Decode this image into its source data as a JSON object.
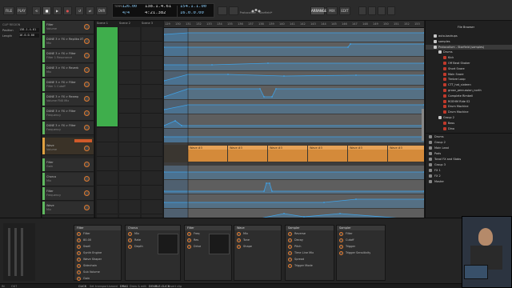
{
  "toolbar": {
    "buttons": [
      "FILE",
      "PLAY",
      "⟲",
      "■",
      "▶",
      "●",
      "↺",
      "⇄",
      "OVR"
    ],
    "tempo": "126.00",
    "tempo_label": "TEMPO",
    "signature": "4/4",
    "position_main": "138.1.4.61",
    "position_sub": "4:21.382",
    "loop_start": "154.1.1.00",
    "loop_len": "16.0.0.00",
    "right_buttons": [
      "ARRANGE",
      "MIX",
      "EDIT"
    ],
    "title": "Protocollum - Starfield*"
  },
  "inspector": {
    "header": "CLIP REGION",
    "rows": [
      {
        "label": "Position",
        "value": "138.1.4.61"
      },
      {
        "label": "Length",
        "value": "16.0.0.00"
      }
    ]
  },
  "tracks": [
    {
      "name": "Filter",
      "sub": "Volume",
      "color": "#5fb85f"
    },
    {
      "name": "DUNE 3 > FX > Replika XT",
      "sub": "Mix",
      "color": "#5fb85f"
    },
    {
      "name": "DUNE 3 > FX > Filter",
      "sub": "Filter 1 Resonance",
      "color": "#5fb85f"
    },
    {
      "name": "DUNE 3 > FX > Reverb",
      "sub": "Mix",
      "color": "#5fb85f"
    },
    {
      "name": "DUNE 3 > FX > Filter",
      "sub": "Filter 1 Cutoff",
      "color": "#5fb85f"
    },
    {
      "name": "DUNE 3 > FX > Reamp",
      "sub": "Volume FNX Mix",
      "color": "#5fb85f"
    },
    {
      "name": "DUNE 3 > FX > Filter",
      "sub": "Frequency",
      "color": "#5fb85f"
    },
    {
      "name": "DUNE 3 > FX > Filter",
      "sub": "Frequency",
      "color": "#5fb85f"
    },
    {
      "name": "Wave",
      "sub": "Volume",
      "color": "#e0a040"
    },
    {
      "name": "Filter",
      "sub": "Gain",
      "color": "#5fb85f"
    },
    {
      "name": "Chorus",
      "sub": "Mix",
      "color": "#5fb85f"
    },
    {
      "name": "Filter",
      "sub": "Frequency",
      "color": "#5fb85f"
    },
    {
      "name": "Wave",
      "sub": "Mix",
      "color": "#5fb85f"
    }
  ],
  "launcher": {
    "scenes": [
      "Scene 1",
      "Scene 2",
      "Scene 3"
    ]
  },
  "arranger": {
    "ruler_marks": [
      "129",
      "130",
      "131",
      "132",
      "133",
      "134",
      "135",
      "136",
      "137",
      "138",
      "139",
      "140",
      "141",
      "142",
      "143",
      "144",
      "145",
      "146",
      "147",
      "148",
      "149",
      "150",
      "151",
      "152",
      "153"
    ],
    "clips": [
      "Wave #3",
      "Wave #3",
      "Wave #3",
      "Wave #3",
      "Wave #3",
      "Wave #3"
    ]
  },
  "browser": {
    "title": "File Browser",
    "tree": [
      {
        "label": "auto-backups",
        "depth": 1,
        "type": "folder"
      },
      {
        "label": "samples",
        "depth": 1,
        "type": "folder"
      },
      {
        "label": "Protocollum - Starfield (samples)",
        "depth": 1,
        "type": "folder",
        "selected": true
      },
      {
        "label": "Drums",
        "depth": 2,
        "type": "folder"
      },
      {
        "label": "Kick",
        "depth": 3,
        "type": "file"
      },
      {
        "label": "Off Beat Shaker",
        "depth": 3,
        "type": "file"
      },
      {
        "label": "Short Snare",
        "depth": 3,
        "type": "file"
      },
      {
        "label": "Main Snare",
        "depth": 3,
        "type": "file"
      },
      {
        "label": "Timbre Loop",
        "depth": 3,
        "type": "file"
      },
      {
        "label": "CTT_hat_sixteen",
        "depth": 3,
        "type": "file"
      },
      {
        "label": "groov_percussion_north",
        "depth": 3,
        "type": "file"
      },
      {
        "label": "Complete Rimbell",
        "depth": 3,
        "type": "file"
      },
      {
        "label": "ROEHM Ride 02",
        "depth": 3,
        "type": "file"
      },
      {
        "label": "Drum Machine",
        "depth": 3,
        "type": "file"
      },
      {
        "label": "Drum Machine",
        "depth": 3,
        "type": "file"
      },
      {
        "label": "Group 2",
        "depth": 2,
        "type": "folder"
      },
      {
        "label": "Bass",
        "depth": 3,
        "type": "file"
      },
      {
        "label": "Dino",
        "depth": 3,
        "type": "file"
      }
    ],
    "project_tracks": [
      "Drums",
      "Group 2",
      "Main Lead",
      "Pads",
      "Tonal FX and Stabs",
      "Group 3",
      "FX 1",
      "FX 2",
      "Master"
    ]
  },
  "devices": [
    {
      "title": "Filter",
      "params": [
        "Filter",
        "80.00",
        "Swell",
        "Synth Engine",
        "Wave Shaper",
        "Sidechain",
        "Sub Volume",
        "Gain"
      ]
    },
    {
      "title": "Chorus",
      "params": [
        "Mix",
        "Rate",
        "Depth"
      ]
    },
    {
      "title": "Filter",
      "params": [
        "Freq",
        "Res",
        "Drive"
      ]
    },
    {
      "title": "Wave",
      "params": [
        "Mix",
        "Tone",
        "Shape"
      ]
    },
    {
      "title": "Sampler",
      "params": [
        "Reverse",
        "Decay",
        "Pitch",
        "Time Line Mix",
        "Spread",
        "Trigger Mode"
      ]
    },
    {
      "title": "Sampler",
      "params": [
        "Filter",
        "Cutoff",
        "Trigger",
        "Trigger Sensitivity"
      ]
    }
  ],
  "statusbar": {
    "left": [
      "IN",
      "OUT"
    ],
    "items": [
      "CLICK",
      "Set transport-based",
      "DRAG",
      "Draw & edit",
      "DOUBLE-CLICK",
      "Insert clip"
    ]
  },
  "colors": {
    "accent": "#e07a2f",
    "green": "#5fb85f",
    "automation": "#3fa3e8",
    "clip_orange": "#d48a3a"
  }
}
